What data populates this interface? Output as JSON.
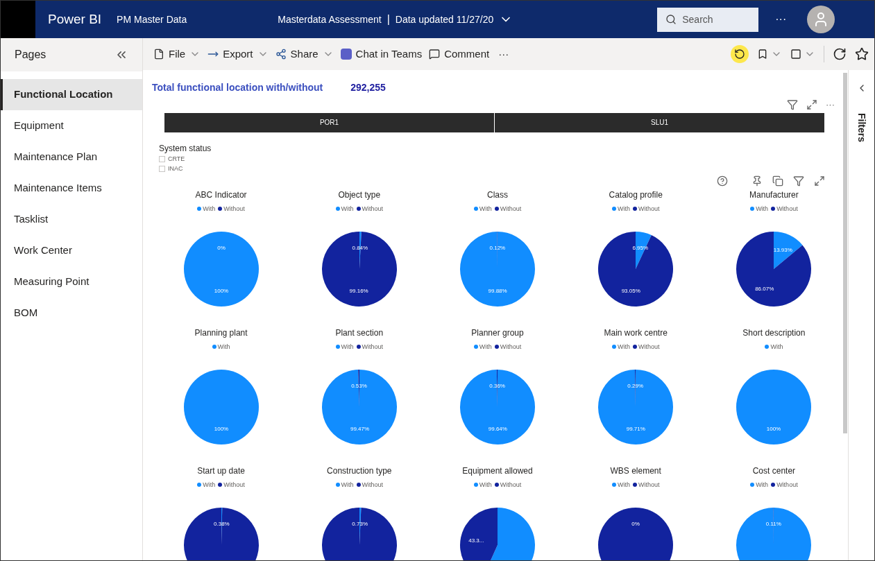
{
  "app_bar": {
    "product": "Power BI",
    "workspace": "PM Master Data",
    "report": "Masterdata Assessment",
    "separator": "|",
    "updated": "Data updated 11/27/20",
    "search": {
      "placeholder": "Search"
    },
    "more": "···"
  },
  "toolbar": {
    "items": [
      {
        "kind": "file",
        "label": "File",
        "menu": true
      },
      {
        "kind": "export",
        "label": "Export",
        "menu": true
      },
      {
        "kind": "share",
        "label": "Share",
        "menu": true
      },
      {
        "kind": "teams",
        "label": "Chat in Teams",
        "menu": false
      },
      {
        "kind": "comment",
        "label": "Comment",
        "menu": false
      }
    ],
    "more": "···"
  },
  "pages": {
    "title": "Pages",
    "items": [
      {
        "label": "Functional Location",
        "selected": true
      },
      {
        "label": "Equipment",
        "selected": false
      },
      {
        "label": "Maintenance Plan",
        "selected": false
      },
      {
        "label": "Maintenance Items",
        "selected": false
      },
      {
        "label": "Tasklist",
        "selected": false
      },
      {
        "label": "Work Center",
        "selected": false
      },
      {
        "label": "Measuring Point",
        "selected": false
      },
      {
        "label": "BOM",
        "selected": false
      }
    ]
  },
  "filters_pane": {
    "title": "Filters"
  },
  "report": {
    "total_label": "Total functional location with/without",
    "total_value": "292,255",
    "visual_more": "···",
    "plant_slicer": [
      "POR1",
      "SLU1"
    ],
    "status_slicer": {
      "title": "System status",
      "options": [
        {
          "label": "CRTE",
          "checked": false
        },
        {
          "label": "INAC",
          "checked": false
        }
      ]
    },
    "charts": [
      {
        "title": "ABC Indicator",
        "legend": [
          {
            "color": "#118dff"
          },
          {
            "color": "#12239e"
          }
        ],
        "chart_data": {
          "type": "pie",
          "categories": [
            "With",
            "Without"
          ],
          "values": [
            100,
            0
          ],
          "value_labels": [
            "100%",
            "0%"
          ]
        }
      },
      {
        "title": "Object type",
        "legend": [
          {
            "color": "#118dff"
          },
          {
            "color": "#12239e"
          }
        ],
        "chart_data": {
          "type": "pie",
          "categories": [
            "With",
            "Without"
          ],
          "values": [
            0.84,
            99.16
          ],
          "value_labels": [
            "0.84%",
            "99.16%"
          ]
        }
      },
      {
        "title": "Class",
        "legend": [
          {
            "color": "#118dff"
          },
          {
            "color": "#12239e"
          }
        ],
        "chart_data": {
          "type": "pie",
          "categories": [
            "With",
            "Without"
          ],
          "values": [
            99.88,
            0.12
          ],
          "value_labels": [
            "99.88%",
            "0.12%"
          ]
        }
      },
      {
        "title": "Catalog profile",
        "legend": [
          {
            "color": "#118dff"
          },
          {
            "color": "#12239e"
          }
        ],
        "chart_data": {
          "type": "pie",
          "categories": [
            "With",
            "Without"
          ],
          "values": [
            6.95,
            93.05
          ],
          "value_labels": [
            "6.95%",
            "93.05%"
          ]
        }
      },
      {
        "title": "Manufacturer",
        "legend": [
          {
            "color": "#118dff"
          },
          {
            "color": "#12239e"
          }
        ],
        "chart_data": {
          "type": "pie",
          "categories": [
            "With",
            "Without"
          ],
          "values": [
            13.93,
            86.07
          ],
          "value_labels": [
            "13.93%",
            "86.07%"
          ]
        }
      },
      {
        "title": "Planning plant",
        "legend": [
          {
            "color": "#118dff"
          }
        ],
        "chart_data": {
          "type": "pie",
          "categories": [
            "With"
          ],
          "values": [
            100
          ],
          "value_labels": [
            "100%"
          ]
        }
      },
      {
        "title": "Plant section",
        "legend": [
          {
            "color": "#118dff"
          },
          {
            "color": "#12239e"
          }
        ],
        "chart_data": {
          "type": "pie",
          "categories": [
            "With",
            "Without"
          ],
          "values": [
            99.47,
            0.53
          ],
          "value_labels": [
            "99.47%",
            "0.53%"
          ]
        }
      },
      {
        "title": "Planner group",
        "legend": [
          {
            "color": "#118dff"
          },
          {
            "color": "#12239e"
          }
        ],
        "chart_data": {
          "type": "pie",
          "categories": [
            "With",
            "Without"
          ],
          "values": [
            99.64,
            0.36
          ],
          "value_labels": [
            "99.64%",
            "0.36%"
          ]
        }
      },
      {
        "title": "Main work centre",
        "legend": [
          {
            "color": "#118dff"
          },
          {
            "color": "#12239e"
          }
        ],
        "chart_data": {
          "type": "pie",
          "categories": [
            "With",
            "Without"
          ],
          "values": [
            99.71,
            0.29
          ],
          "value_labels": [
            "99.71%",
            "0.29%"
          ]
        }
      },
      {
        "title": "Short description",
        "legend": [
          {
            "color": "#118dff"
          }
        ],
        "chart_data": {
          "type": "pie",
          "categories": [
            "With"
          ],
          "values": [
            100
          ],
          "value_labels": [
            "100%"
          ]
        }
      },
      {
        "title": "Start up date",
        "legend": [
          {
            "color": "#118dff"
          },
          {
            "color": "#12239e"
          }
        ],
        "chart_data": {
          "type": "pie",
          "categories": [
            "With",
            "Without"
          ],
          "values": [
            0.38,
            99.62
          ],
          "value_labels": [
            "0.38%",
            null
          ]
        }
      },
      {
        "title": "Construction type",
        "legend": [
          {
            "color": "#118dff"
          },
          {
            "color": "#12239e"
          }
        ],
        "chart_data": {
          "type": "pie",
          "categories": [
            "With",
            "Without"
          ],
          "values": [
            0.73,
            99.27
          ],
          "value_labels": [
            "0.73%",
            null
          ]
        }
      },
      {
        "title": "Equipment allowed",
        "legend": [
          {
            "color": "#118dff"
          },
          {
            "color": "#12239e"
          }
        ],
        "chart_data": {
          "type": "pie",
          "categories": [
            "With",
            "Without"
          ],
          "values": [
            56.7,
            43.3
          ],
          "value_labels": [
            null,
            "43.3..."
          ]
        }
      },
      {
        "title": "WBS element",
        "legend": [
          {
            "color": "#118dff"
          },
          {
            "color": "#12239e"
          }
        ],
        "chart_data": {
          "type": "pie",
          "categories": [
            "With",
            "Without"
          ],
          "values": [
            0,
            100
          ],
          "value_labels": [
            "0%",
            null
          ]
        }
      },
      {
        "title": "Cost center",
        "legend": [
          {
            "color": "#118dff"
          },
          {
            "color": "#12239e"
          }
        ],
        "chart_data": {
          "type": "pie",
          "categories": [
            "With",
            "Without"
          ],
          "values": [
            99.89,
            0.11
          ],
          "value_labels": [
            null,
            "0.11%"
          ]
        }
      }
    ]
  }
}
